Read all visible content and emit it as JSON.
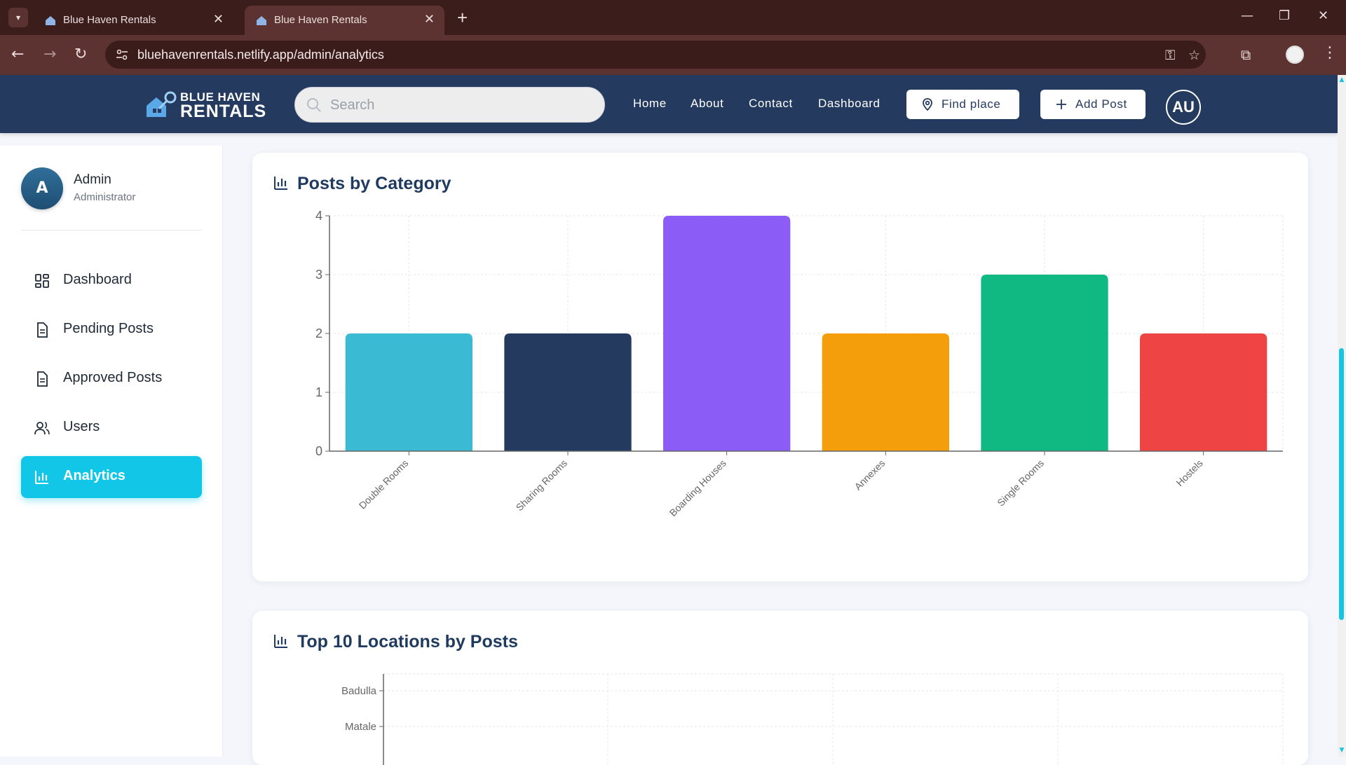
{
  "browser": {
    "tabs": [
      {
        "title": "Blue Haven Rentals",
        "active": false
      },
      {
        "title": "Blue Haven Rentals",
        "active": true
      }
    ],
    "url": "bluehavenrentals.netlify.app/admin/analytics"
  },
  "header": {
    "logo_line1": "BLUE HAVEN",
    "logo_line2": "RENTALS",
    "search_placeholder": "Search",
    "nav": [
      "Home",
      "About",
      "Contact",
      "Dashboard"
    ],
    "find_place": "Find place",
    "add_post": "Add Post",
    "avatar_initials": "AU"
  },
  "sidebar": {
    "avatar_letter": "A",
    "name": "Admin",
    "role": "Administrator",
    "items": [
      {
        "label": "Dashboard",
        "icon": "grid-icon"
      },
      {
        "label": "Pending Posts",
        "icon": "document-icon"
      },
      {
        "label": "Approved Posts",
        "icon": "document-icon"
      },
      {
        "label": "Users",
        "icon": "users-icon"
      },
      {
        "label": "Analytics",
        "icon": "bar-chart-icon",
        "active": true
      }
    ]
  },
  "cards": {
    "posts_title": "Posts by Category",
    "locations_title": "Top 10 Locations by Posts"
  },
  "colors": {
    "brand": "#243a5e",
    "accent": "#12c6e8"
  },
  "chart_data": [
    {
      "type": "bar",
      "title": "Posts by Category",
      "categories": [
        "Double Rooms",
        "Sharing Rooms",
        "Boarding Houses",
        "Annexes",
        "Single Rooms",
        "Hostels"
      ],
      "values": [
        2,
        2,
        4,
        2,
        3,
        2
      ],
      "colors": [
        "#3bbad3",
        "#243a5e",
        "#8b5cf6",
        "#f59e0b",
        "#10b981",
        "#ef4444"
      ],
      "ylim": [
        0,
        4
      ],
      "yticks": [
        0,
        1,
        2,
        3,
        4
      ],
      "grid": true
    },
    {
      "type": "bar",
      "orientation": "horizontal",
      "title": "Top 10 Locations by Posts",
      "categories": [
        "Badulla",
        "Matale"
      ],
      "grid": true
    }
  ]
}
